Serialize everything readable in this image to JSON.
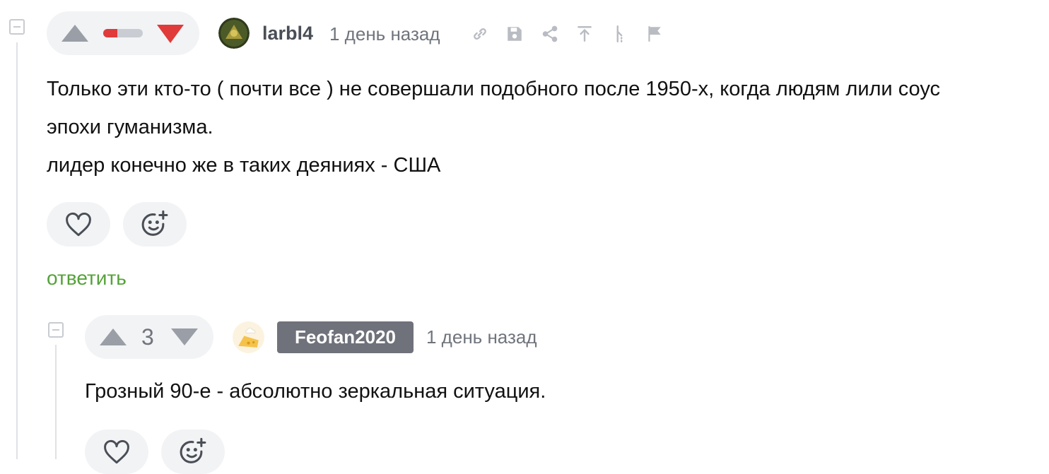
{
  "comment1": {
    "author": "larbl4",
    "time": "1 день назад",
    "rating_negative_fraction": 0.35,
    "text_lines": [
      "Только эти кто-то ( почти все ) не совершали подобного после 1950-х, когда людям лили соус",
      "эпохи гуманизма.",
      "лидер конечно же в таких деяниях - США"
    ],
    "reply_label": "ответить",
    "toolbar_icons": [
      "link-icon",
      "save-icon",
      "share-icon",
      "scroll-up-icon",
      "branch-icon",
      "flag-icon"
    ]
  },
  "comment2": {
    "author": "Feofan2020",
    "time": "1 день назад",
    "rating": "3",
    "text": "Грозный 90-е - абсолютно зеркальная ситуация."
  },
  "colors": {
    "accent_green": "#55a23a",
    "downvote_red": "#e03a3a",
    "badge_gray": "#6f727a"
  }
}
